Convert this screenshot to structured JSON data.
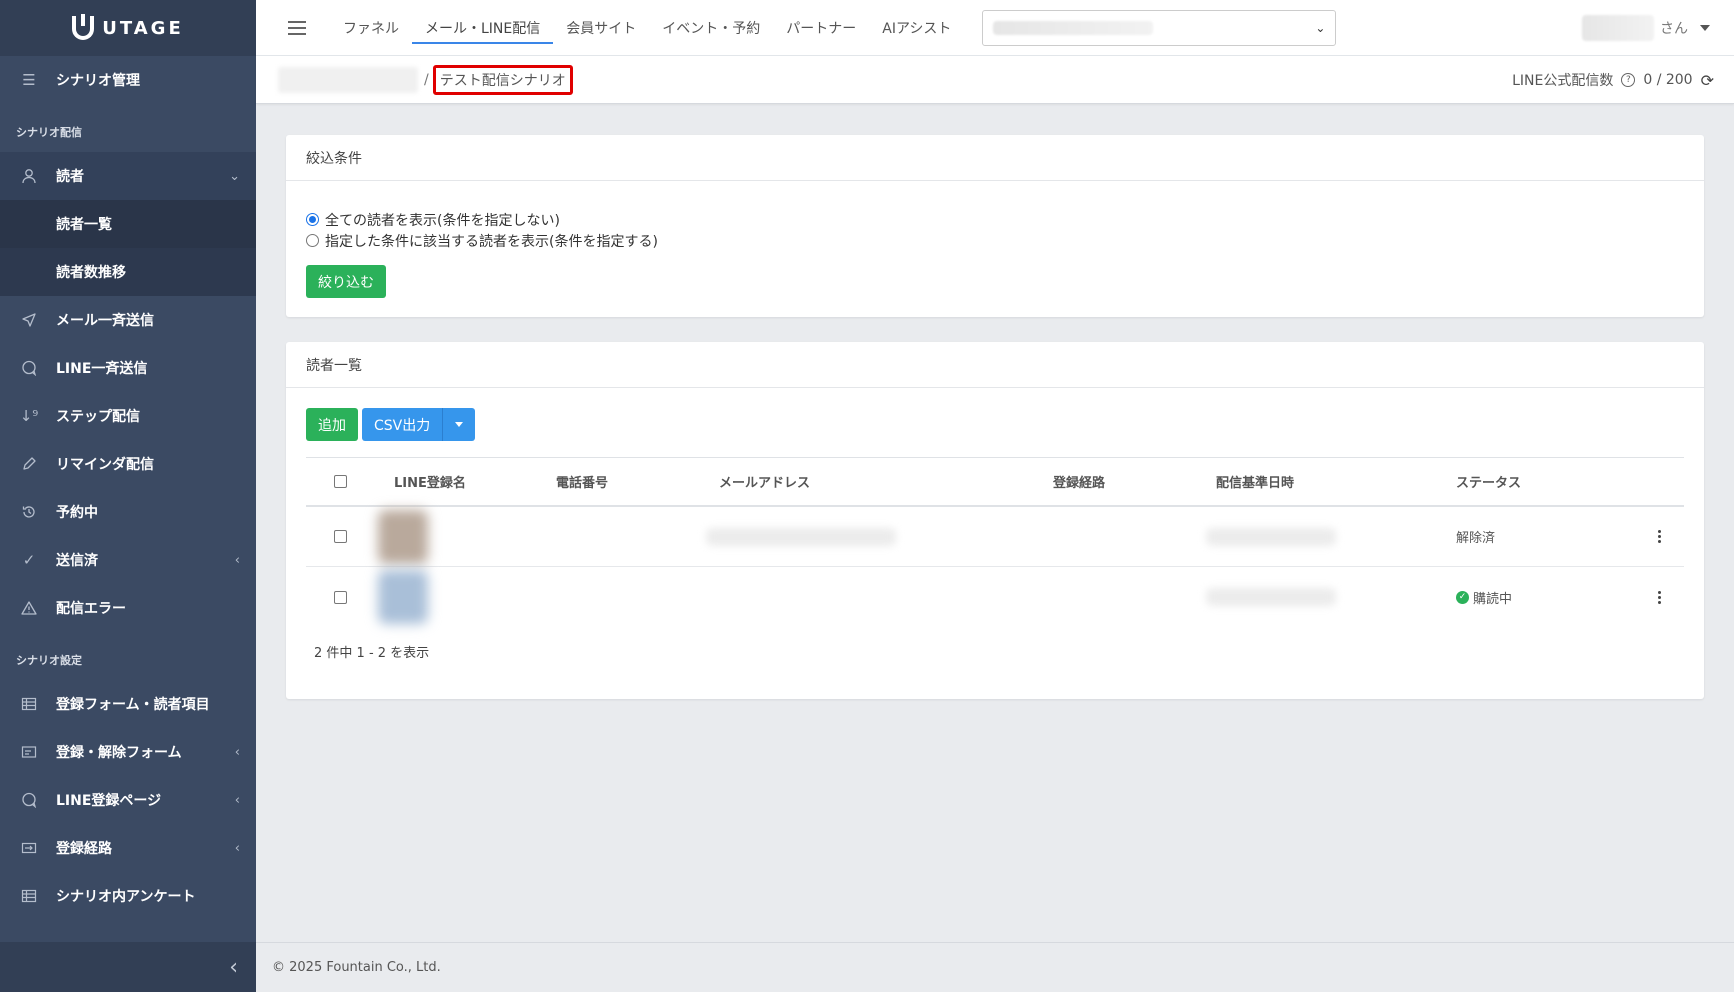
{
  "app": {
    "logo_text": "UTAGE"
  },
  "sidebar": {
    "top_item": {
      "label": "シナリオ管理",
      "icon": "list-icon"
    },
    "section1": "シナリオ配信",
    "readers": {
      "label": "読者",
      "icon": "user-icon"
    },
    "readers_sub": [
      {
        "label": "読者一覧"
      },
      {
        "label": "読者数推移"
      }
    ],
    "items1": [
      {
        "label": "メール一斉送信",
        "icon": "send-icon"
      },
      {
        "label": "LINE一斉送信",
        "icon": "chat-icon"
      },
      {
        "label": "ステップ配信",
        "icon": "sort-icon"
      },
      {
        "label": "リマインダ配信",
        "icon": "pencil-icon"
      },
      {
        "label": "予約中",
        "icon": "history-icon"
      },
      {
        "label": "送信済",
        "icon": "check-icon"
      },
      {
        "label": "配信エラー",
        "icon": "warning-icon"
      }
    ],
    "section2": "シナリオ設定",
    "items2": [
      {
        "label": "登録フォーム・読者項目",
        "icon": "table-icon"
      },
      {
        "label": "登録・解除フォーム",
        "icon": "form-icon"
      },
      {
        "label": "LINE登録ページ",
        "icon": "chat-icon"
      },
      {
        "label": "登録経路",
        "icon": "route-icon"
      },
      {
        "label": "シナリオ内アンケート",
        "icon": "table-icon"
      }
    ]
  },
  "header": {
    "tabs": [
      "ファネル",
      "メール・LINE配信",
      "会員サイト",
      "イベント・予約",
      "パートナー",
      "AIアシスト"
    ],
    "active_tab": "メール・LINE配信",
    "user_suffix": "さん"
  },
  "breadcrumb": {
    "separator": "/",
    "current": "テスト配信シナリオ"
  },
  "line_count": {
    "label": "LINE公式配信数",
    "value": "0 / 200"
  },
  "filter_card": {
    "title": "絞込条件",
    "options": [
      {
        "label": "全ての読者を表示(条件を指定しない)",
        "checked": true
      },
      {
        "label": "指定した条件に該当する読者を表示(条件を指定する)",
        "checked": false
      }
    ],
    "button": "絞り込む"
  },
  "list_card": {
    "title": "読者一覧",
    "add_button": "追加",
    "csv_button": "CSV出力",
    "columns": [
      "LINE登録名",
      "電話番号",
      "メールアドレス",
      "登録経路",
      "配信基準日時",
      "ステータス"
    ],
    "rows": [
      {
        "status": "解除済"
      },
      {
        "status": "購読中"
      }
    ],
    "pagination": "2 件中 1 - 2 を表示"
  },
  "footer": {
    "copyright": "© 2025 Fountain Co., Ltd."
  },
  "colors": {
    "sidebar": "#3b4a63",
    "green": "#2bb15a",
    "blue": "#3696ec",
    "highlight": "#e00000"
  }
}
